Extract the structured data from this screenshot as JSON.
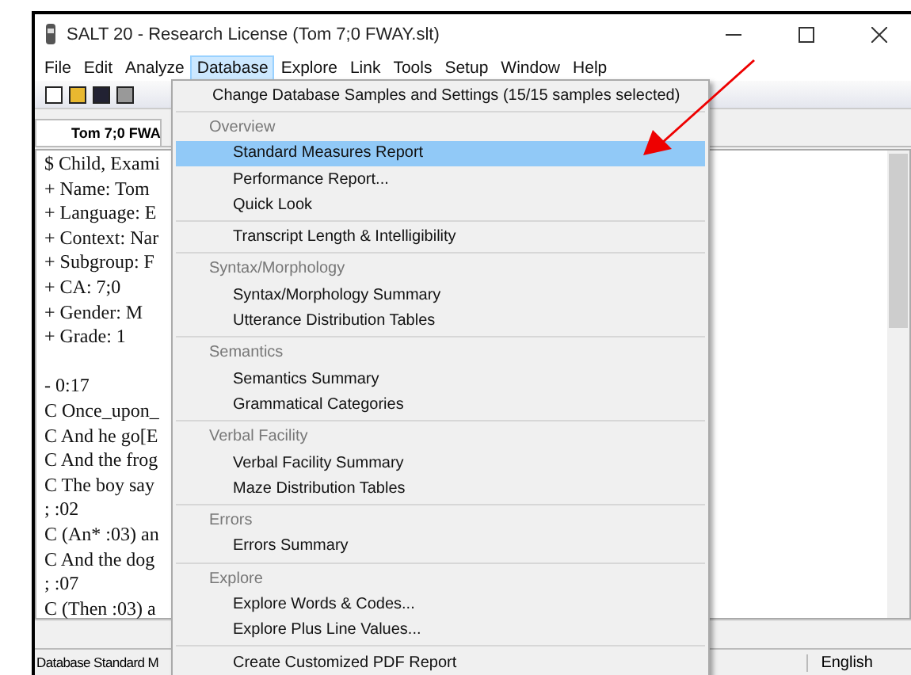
{
  "window": {
    "title": "SALT 20 - Research License (Tom 7;0 FWAY.slt)"
  },
  "menu_bar": [
    {
      "label": "File",
      "selected": false
    },
    {
      "label": "Edit",
      "selected": false
    },
    {
      "label": "Analyze",
      "selected": false
    },
    {
      "label": "Database",
      "selected": true
    },
    {
      "label": "Explore",
      "selected": false
    },
    {
      "label": "Link",
      "selected": false
    },
    {
      "label": "Tools",
      "selected": false
    },
    {
      "label": "Setup",
      "selected": false
    },
    {
      "label": "Window",
      "selected": false
    },
    {
      "label": "Help",
      "selected": false
    }
  ],
  "document_tab": {
    "label": "Tom 7;0 FWA"
  },
  "transcript_blocks": [
    [
      "$ Child, Exami",
      "+ Name: Tom",
      "+ Language: E",
      "+ Context: Nar",
      "+ Subgroup: F",
      "+ CA: 7;0",
      "+ Gender: M",
      "+ Grade: 1"
    ],
    [
      "- 0:17",
      "C Once_upon_",
      "C And he go[E",
      "C And the frog",
      "C The boy say",
      "; :02",
      "C (An* :03) an",
      "C And the dog",
      "; :07",
      "C (Then :03) a"
    ]
  ],
  "dropdown_menu": [
    {
      "items": [
        {
          "label": "Change Database Samples and Settings (15/15 samples selected)",
          "selected": false
        }
      ]
    },
    {
      "header": "Overview",
      "items": [
        {
          "label": "Standard Measures Report",
          "selected": true
        },
        {
          "label": "Performance Report...",
          "selected": false
        },
        {
          "label": "Quick Look",
          "selected": false
        }
      ]
    },
    {
      "items": [
        {
          "label": "Transcript Length & Intelligibility",
          "selected": false
        }
      ]
    },
    {
      "header": "Syntax/Morphology",
      "items": [
        {
          "label": "Syntax/Morphology Summary",
          "selected": false
        },
        {
          "label": "Utterance Distribution Tables",
          "selected": false
        }
      ]
    },
    {
      "header": "Semantics",
      "items": [
        {
          "label": "Semantics Summary",
          "selected": false
        },
        {
          "label": "Grammatical Categories",
          "selected": false
        }
      ]
    },
    {
      "header": "Verbal Facility",
      "items": [
        {
          "label": "Verbal Facility Summary",
          "selected": false
        },
        {
          "label": "Maze Distribution Tables",
          "selected": false
        }
      ]
    },
    {
      "header": "Errors",
      "items": [
        {
          "label": "Errors Summary",
          "selected": false
        }
      ]
    },
    {
      "header": "Explore",
      "items": [
        {
          "label": "Explore Words & Codes...",
          "selected": false
        },
        {
          "label": "Explore Plus Line Values...",
          "selected": false
        }
      ]
    },
    {
      "items": [
        {
          "label": "Create Customized PDF Report",
          "selected": false
        }
      ]
    }
  ],
  "status_bar": {
    "message": "Database Standard M",
    "language": "English"
  }
}
